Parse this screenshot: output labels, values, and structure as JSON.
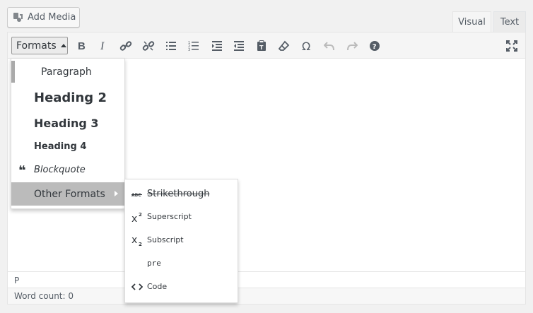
{
  "header": {
    "add_media_label": "Add Media",
    "tabs": [
      {
        "label": "Visual",
        "active": true
      },
      {
        "label": "Text",
        "active": false
      }
    ]
  },
  "toolbar": {
    "formats_label": "Formats",
    "icons": [
      "bold-icon",
      "italic-icon",
      "link-icon",
      "unlink-icon",
      "bullet-list-icon",
      "numbered-list-icon",
      "indent-icon",
      "outdent-icon",
      "paste-text-icon",
      "clear-formatting-icon",
      "special-character-icon",
      "undo-icon",
      "redo-icon",
      "help-icon",
      "fullscreen-icon"
    ]
  },
  "formats_menu": {
    "items": [
      {
        "label": "Paragraph"
      },
      {
        "label": "Heading 2"
      },
      {
        "label": "Heading 3"
      },
      {
        "label": "Heading 4"
      },
      {
        "label": "Blockquote"
      },
      {
        "label": "Other Formats"
      }
    ]
  },
  "submenu": {
    "items": [
      {
        "label": "Strikethrough"
      },
      {
        "label": "Superscript"
      },
      {
        "label": "Subscript"
      },
      {
        "label": "pre"
      },
      {
        "label": "Code"
      }
    ]
  },
  "status": {
    "path": "P",
    "word_count": "Word count: 0"
  },
  "colors": {
    "background": "#f1f1f1",
    "toolbar": "#f5f5f5",
    "menu_highlight": "#bbbbbb",
    "text": "#32373c"
  }
}
